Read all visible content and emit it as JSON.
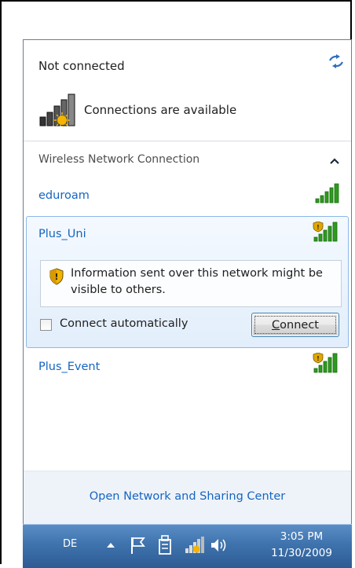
{
  "status": {
    "title": "Not connected",
    "available_text": "Connections are available"
  },
  "section": {
    "header": "Wireless Network Connection"
  },
  "networks": [
    {
      "name": "eduroam",
      "signal_bars": 5,
      "secured": true
    },
    {
      "name": "Plus_Uni",
      "signal_bars": 5,
      "secured": false,
      "selected": true
    },
    {
      "name": "Plus_Event",
      "signal_bars": 5,
      "secured": false
    }
  ],
  "selected_panel": {
    "warning_text": "Information sent over this network might be visible to others.",
    "auto_connect_label": "Connect automatically",
    "auto_connect_checked": false,
    "connect_label_accesskey": "C",
    "connect_label_rest": "onnect"
  },
  "footer": {
    "link_text": "Open Network and Sharing Center"
  },
  "taskbar": {
    "language": "DE",
    "time": "3:05 PM",
    "date": "11/30/2009"
  },
  "colors": {
    "link": "#1565c0",
    "signal": "#2e9a1f",
    "taskbar": "#3f73ad"
  }
}
